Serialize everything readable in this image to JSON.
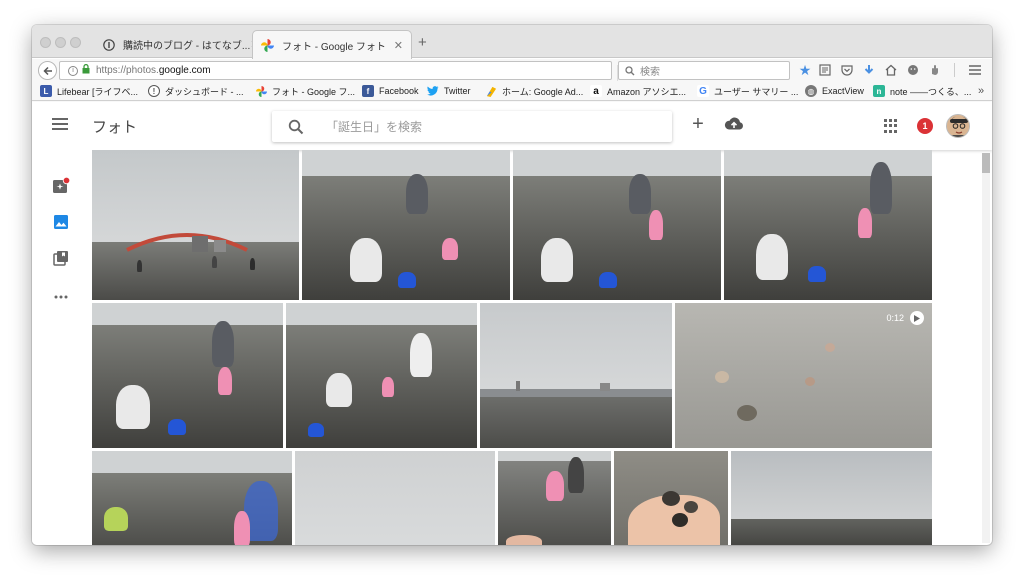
{
  "browser": {
    "tabs": [
      {
        "title": "購読中のブログ - はてなブ...",
        "active": false
      },
      {
        "title": "フォト - Google フォト",
        "active": true
      }
    ],
    "url_prefix": "https://photos.",
    "url_domain": "google.com",
    "search_placeholder": "検索",
    "bookmarks": [
      {
        "label": "Lifebear [ライフベ...",
        "color": "#3b5bab",
        "icon": "lifebear-icon"
      },
      {
        "label": "ダッシュボード - ...",
        "color": "#555555",
        "icon": "hatena-icon"
      },
      {
        "label": "フォト - Google フ...",
        "color": "#f4b400",
        "icon": "google-photos-icon"
      },
      {
        "label": "Facebook",
        "color": "#3b5998",
        "icon": "facebook-icon"
      },
      {
        "label": "Twitter",
        "color": "#1da1f2",
        "icon": "twitter-icon"
      },
      {
        "label": "ホーム: Google Ad...",
        "color": "#f4b400",
        "icon": "adsense-icon"
      },
      {
        "label": "Amazon アソシエ...",
        "color": "#222222",
        "icon": "amazon-icon"
      },
      {
        "label": "ユーザー サマリー ...",
        "color": "#4285f4",
        "icon": "google-icon"
      },
      {
        "label": "ExactView",
        "color": "#777777",
        "icon": "globe-icon"
      },
      {
        "label": "note ――つくる、...",
        "color": "#2cb696",
        "icon": "note-icon"
      }
    ]
  },
  "app": {
    "title": "フォト",
    "search_placeholder": "「誕生日」を検索",
    "notification_count": "1",
    "accent": "#db3236"
  },
  "photos": [
    {
      "row": 1,
      "scene": "shore-bridge"
    },
    {
      "row": 1,
      "scene": "clam-digging"
    },
    {
      "row": 1,
      "scene": "clam-digging"
    },
    {
      "row": 1,
      "scene": "clam-digging"
    },
    {
      "row": 2,
      "scene": "clam-digging"
    },
    {
      "row": 2,
      "scene": "clam-digging"
    },
    {
      "row": 2,
      "scene": "industrial-skyline"
    },
    {
      "row": 2,
      "scene": "shells-video",
      "video_duration": "0:12"
    },
    {
      "row": 3,
      "scene": "clam-digging"
    },
    {
      "row": 3,
      "scene": "overcast-sky"
    },
    {
      "row": 3,
      "scene": "clam-digging"
    },
    {
      "row": 3,
      "scene": "clams-in-hand"
    },
    {
      "row": 3,
      "scene": "mudflat"
    }
  ]
}
